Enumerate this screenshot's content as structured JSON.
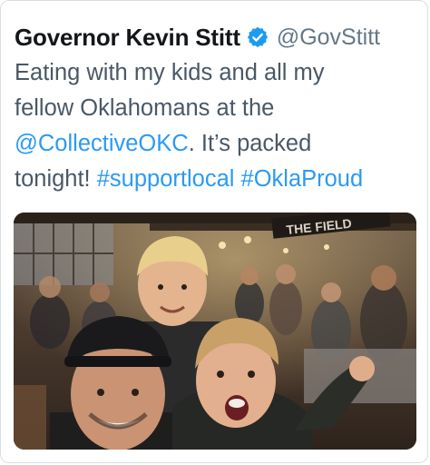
{
  "tweet": {
    "display_name": "Governor Kevin Stitt",
    "handle": "@GovStitt",
    "verified_icon": "verified-badge-icon",
    "text": {
      "line1": "Eating with my kids and all my",
      "line2": "fellow Oklahomans at the",
      "mention": "@CollectiveOKC",
      "line3_rest": ". It’s packed",
      "line4_start": "tonight! ",
      "hashtag1": "#supportlocal",
      "space": " ",
      "hashtag2": "#OklaProud"
    },
    "media": {
      "sign_text": "THE FIELD"
    }
  },
  "colors": {
    "link": "#2b9af3",
    "name": "#14171a",
    "handle": "#657786",
    "text": "#4a5866",
    "verified": "#1d9bf0"
  }
}
